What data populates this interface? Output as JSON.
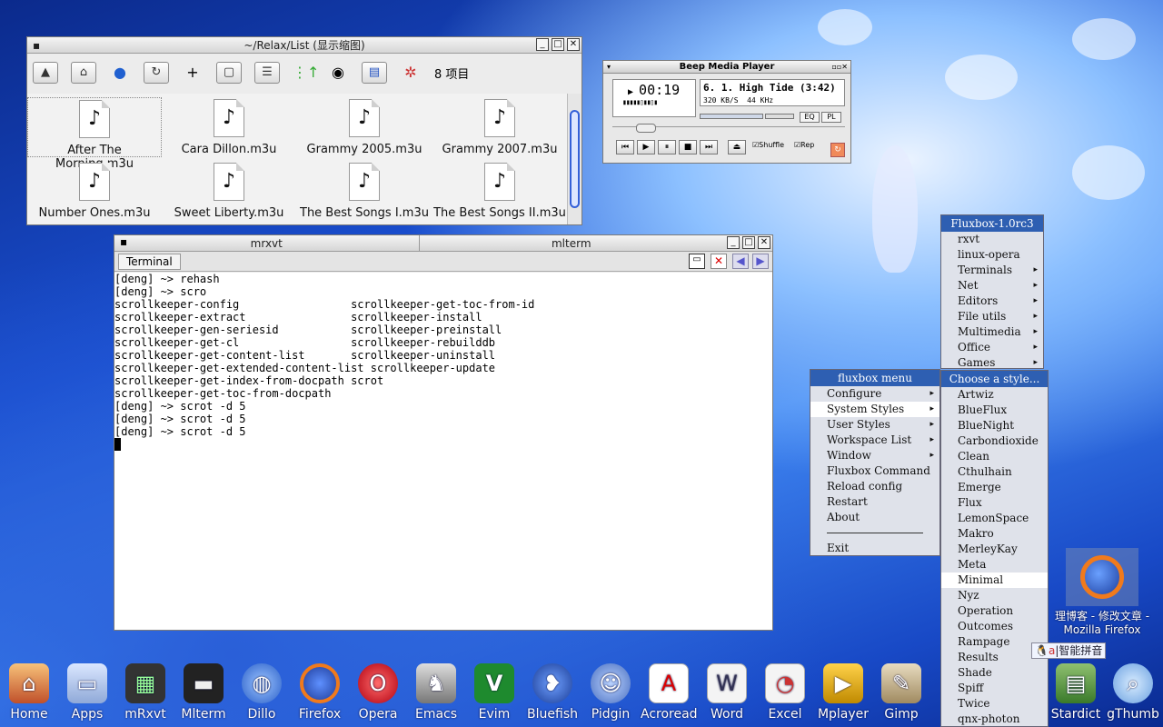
{
  "file_manager": {
    "title": "~/Relax/List (显示缩图)",
    "item_count": "8 项目",
    "files": [
      "After The Morning.m3u",
      "Cara Dillon.m3u",
      "Grammy 2005.m3u",
      "Grammy 2007.m3u",
      "Number Ones.m3u",
      "Sweet Liberty.m3u",
      "The Best Songs I.m3u",
      "The Best Songs II.m3u"
    ]
  },
  "player": {
    "title": "Beep Media Player",
    "time": "00:19",
    "track": "6. 1. High Tide (3:42)",
    "bitrate": "320 KB/S",
    "khz": "44 KHz",
    "eq": "EQ",
    "pl": "PL",
    "shuffle": "Shuffle",
    "repeat": "Rep"
  },
  "terminal": {
    "tab1": "mrxvt",
    "tab2": "mlterm",
    "label": "Terminal",
    "lines": [
      "[deng] ~> rehash",
      "[deng] ~> scro",
      "scrollkeeper-config                 scrollkeeper-get-toc-from-id",
      "scrollkeeper-extract                scrollkeeper-install",
      "scrollkeeper-gen-seriesid           scrollkeeper-preinstall",
      "scrollkeeper-get-cl                 scrollkeeper-rebuilddb",
      "scrollkeeper-get-content-list       scrollkeeper-uninstall",
      "scrollkeeper-get-extended-content-list scrollkeeper-update",
      "scrollkeeper-get-index-from-docpath scrot",
      "scrollkeeper-get-toc-from-docpath",
      "[deng] ~> scrot -d 5",
      "[deng] ~> scrot -d 5",
      "[deng] ~> scrot -d 5"
    ]
  },
  "fluxbox_menu": {
    "title": "fluxbox menu",
    "items": [
      "Configure",
      "System Styles",
      "User Styles",
      "Workspace List",
      "Window",
      "Fluxbox Command",
      "Reload config",
      "Restart",
      "About",
      "Exit"
    ]
  },
  "apps_menu": {
    "title": "Fluxbox-1.0rc3",
    "items": [
      "rxvt",
      "linux-opera",
      "Terminals",
      "Net",
      "Editors",
      "File utils",
      "Multimedia",
      "Office",
      "Games"
    ]
  },
  "styles_menu": {
    "title": "Choose a style...",
    "items": [
      "Artwiz",
      "BlueFlux",
      "BlueNight",
      "Carbondioxide",
      "Clean",
      "Cthulhain",
      "Emerge",
      "Flux",
      "LemonSpace",
      "Makro",
      "MerleyKay",
      "Meta",
      "Minimal",
      "Nyz",
      "Operation",
      "Outcomes",
      "Rampage",
      "Results",
      "Shade",
      "Spiff",
      "Twice",
      "qnx-photon"
    ]
  },
  "firefox_icon": {
    "line1": "理博客 - 修改文章 -",
    "line2": "Mozilla Firefox"
  },
  "input_method": "智能拼音",
  "dock": [
    "Home",
    "Apps",
    "mRxvt",
    "Mlterm",
    "Dillo",
    "Firefox",
    "Opera",
    "Emacs",
    "Evim",
    "Bluefish",
    "Pidgin",
    "Acroread",
    "Word",
    "Excel",
    "Mplayer",
    "Gimp",
    "Stardict",
    "gThumb"
  ]
}
